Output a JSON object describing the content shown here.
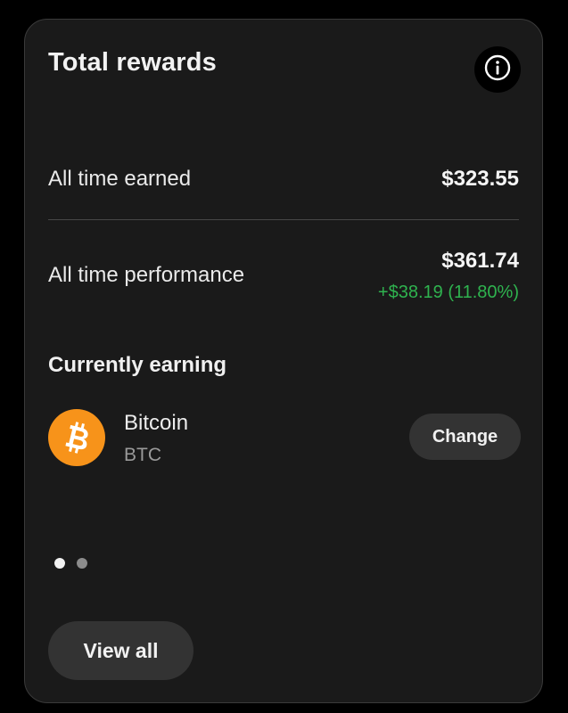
{
  "card": {
    "title": "Total rewards",
    "info_icon": "info-circle-icon"
  },
  "earned": {
    "label": "All time earned",
    "value": "$323.55"
  },
  "performance": {
    "label": "All time performance",
    "value": "$361.74",
    "change": "+$38.19 (11.80%)",
    "change_color": "#2fb34f"
  },
  "currently_earning": {
    "title": "Currently earning",
    "asset_name": "Bitcoin",
    "asset_symbol": "BTC",
    "asset_icon": "bitcoin-icon",
    "asset_color": "#f7931a",
    "change_label": "Change"
  },
  "pager": {
    "count": 2,
    "active_index": 0
  },
  "footer": {
    "view_all_label": "View all"
  }
}
